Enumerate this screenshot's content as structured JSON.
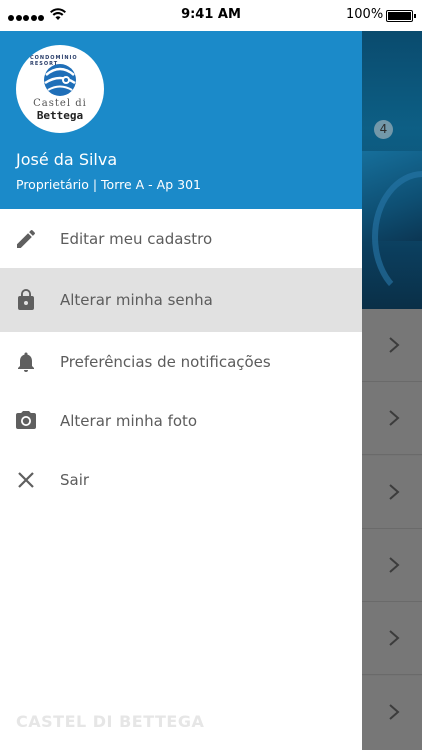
{
  "status_bar": {
    "time": "9:41 AM",
    "battery": "100%"
  },
  "drawer": {
    "logo": {
      "arc_text": "CONDOMÍNIO RESORT",
      "small_text": "Castel di",
      "big_text": "Bettega"
    },
    "user": {
      "name": "José da Silva",
      "role": "Proprietário | Torre A - Ap 301"
    },
    "menu": [
      {
        "label": "Editar meu cadastro",
        "icon": "pencil-icon"
      },
      {
        "label": "Alterar minha senha",
        "icon": "lock-icon",
        "active": true
      },
      {
        "label": "Preferências de notificações",
        "icon": "bell-icon"
      },
      {
        "label": "Alterar minha foto",
        "icon": "camera-icon"
      },
      {
        "label": "Sair",
        "icon": "close-icon"
      }
    ],
    "footer_brand": "CASTEL DI BETTEGA"
  },
  "background": {
    "badge_count": "4",
    "row_count": 6
  },
  "colors": {
    "header_blue": "#1b8ac9",
    "active_row": "#e1e1e1",
    "overlay": "#747474"
  }
}
